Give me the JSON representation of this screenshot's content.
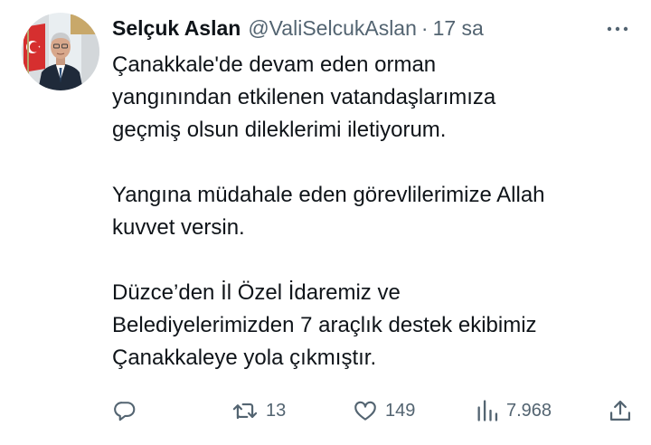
{
  "author": {
    "name": "Selçuk Aslan",
    "handle": "@ValiSelcukAslan",
    "separator": "·",
    "time": "17 sa"
  },
  "body": {
    "paragraphs": [
      [
        "Çanakkale'de devam eden orman",
        "yangınından etkilenen vatandaşlarımıza",
        "geçmiş olsun dileklerimi iletiyorum."
      ],
      [
        "Yangına müdahale eden görevlilerimize Allah",
        "kuvvet versin."
      ],
      [
        "Düzce’den İl Özel İdaremiz ve",
        "Belediyelerimizden 7 araçlık destek ekibimiz",
        "Çanakkaleye yola çıkmıştır."
      ]
    ]
  },
  "actions": {
    "reply": {
      "icon": "reply-icon"
    },
    "retweet": {
      "icon": "retweet-icon",
      "count": "13"
    },
    "like": {
      "icon": "heart-icon",
      "count": "149"
    },
    "views": {
      "icon": "views-icon",
      "count": "7.968"
    },
    "share": {
      "icon": "share-icon"
    }
  },
  "colors": {
    "text": "#0f1419",
    "secondary": "#536471",
    "background": "#ffffff"
  }
}
